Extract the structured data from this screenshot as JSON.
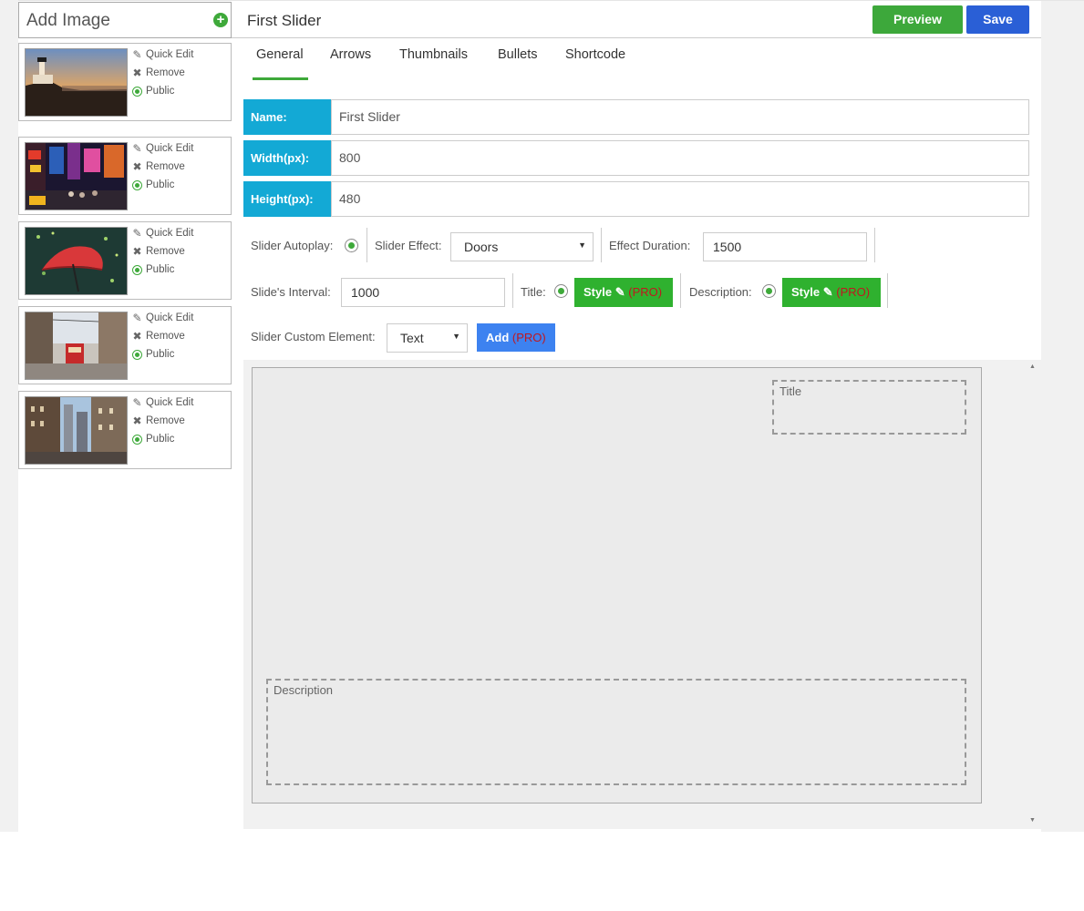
{
  "sidebar": {
    "add_image_label": "Add Image",
    "images": [
      {
        "quick_edit": "Quick Edit",
        "remove": "Remove",
        "visibility": "Public",
        "scene": "lighthouse-sunset"
      },
      {
        "quick_edit": "Quick Edit",
        "remove": "Remove",
        "visibility": "Public",
        "scene": "city-night-street"
      },
      {
        "quick_edit": "Quick Edit",
        "remove": "Remove",
        "visibility": "Public",
        "scene": "red-umbrella"
      },
      {
        "quick_edit": "Quick Edit",
        "remove": "Remove",
        "visibility": "Public",
        "scene": "tram-street"
      },
      {
        "quick_edit": "Quick Edit",
        "remove": "Remove",
        "visibility": "Public",
        "scene": "city-buildings"
      }
    ]
  },
  "header": {
    "title": "First Slider",
    "preview_label": "Preview",
    "save_label": "Save"
  },
  "tabs": [
    {
      "label": "General",
      "active": true
    },
    {
      "label": "Arrows",
      "active": false
    },
    {
      "label": "Thumbnails",
      "active": false
    },
    {
      "label": "Bullets",
      "active": false
    },
    {
      "label": "Shortcode",
      "active": false
    }
  ],
  "fields": {
    "name": {
      "label": "Name:",
      "value": "First Slider"
    },
    "width": {
      "label": "Width(px):",
      "value": "800"
    },
    "height": {
      "label": "Height(px):",
      "value": "480"
    }
  },
  "options": {
    "autoplay_label": "Slider Autoplay:",
    "effect_label": "Slider Effect:",
    "effect_value": "Doors",
    "duration_label": "Effect Duration:",
    "duration_value": "1500",
    "interval_label": "Slide's Interval:",
    "interval_value": "1000",
    "title_label": "Title:",
    "description_label": "Description:",
    "style_label": "Style",
    "pro_label": "(PRO)",
    "custom_element_label": "Slider Custom Element:",
    "custom_element_value": "Text",
    "add_label": "Add"
  },
  "preview": {
    "title_placeholder": "Title",
    "description_placeholder": "Description"
  },
  "colors": {
    "accent_green": "#3ea93a",
    "label_blue": "#13a9d5",
    "save_blue": "#2a5fd6",
    "add_blue": "#3d82f0",
    "pro_red": "#c0181f"
  }
}
